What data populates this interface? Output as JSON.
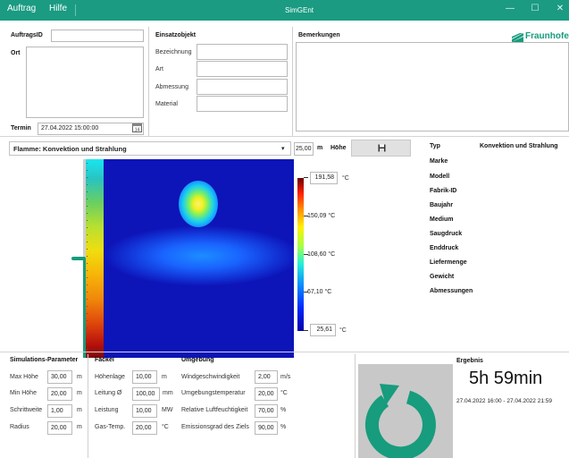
{
  "window": {
    "title": "SimGEnt",
    "menu": [
      "Auftrag",
      "Hilfe"
    ],
    "controls": [
      "—",
      "☐",
      "✕"
    ]
  },
  "order": {
    "id_label": "AuftragsID",
    "id_value": "",
    "place_label": "Ort",
    "date_label": "Termin",
    "date_value": "27.04.2022 15:00:00"
  },
  "object": {
    "title": "Einsatzobjekt",
    "fields": [
      {
        "label": "Bezeichnung",
        "value": ""
      },
      {
        "label": "Art",
        "value": ""
      },
      {
        "label": "Abmessung",
        "value": ""
      },
      {
        "label": "Material",
        "value": ""
      }
    ]
  },
  "remarks": {
    "title": "Bemerkungen",
    "value": ""
  },
  "logo": {
    "text": "Fraunhofer",
    "color": "#179c7d"
  },
  "flame": {
    "selected": "Flamme: Konvektion und Strahlung",
    "height_value": "25,00",
    "height_unit": "m",
    "height_label": "Höhe",
    "slider_level": 0.5
  },
  "heatmap": {
    "max_label": "191,58",
    "max_unit": "°C",
    "min_label": "25,61",
    "min_unit": "°C",
    "ticks": [
      "150,09 °C",
      "108,60 °C",
      "67,10 °C"
    ]
  },
  "info": {
    "rows": [
      {
        "label": "Typ",
        "value": "Konvektion und Strahlung"
      },
      {
        "label": "Marke",
        "value": ""
      },
      {
        "label": "Modell",
        "value": ""
      },
      {
        "label": "Fabrik-ID",
        "value": ""
      },
      {
        "label": "Baujahr",
        "value": ""
      },
      {
        "label": "Medium",
        "value": ""
      },
      {
        "label": "Saugdruck",
        "value": ""
      },
      {
        "label": "Enddruck",
        "value": ""
      },
      {
        "label": "Liefermenge",
        "value": ""
      },
      {
        "label": "Gewicht",
        "value": ""
      },
      {
        "label": "Abmessungen",
        "value": ""
      }
    ]
  },
  "sim_params": {
    "title": "Simulations-Parameter",
    "rows": [
      {
        "label": "Max Höhe",
        "value": "30,00",
        "unit": "m"
      },
      {
        "label": "Min Höhe",
        "value": "20,00",
        "unit": "m"
      },
      {
        "label": "Schrittweite",
        "value": "1,00",
        "unit": "m"
      },
      {
        "label": "Radius",
        "value": "20,00",
        "unit": "m"
      }
    ]
  },
  "torch": {
    "title": "Fackel",
    "rows": [
      {
        "label": "Höhenlage",
        "value": "10,00",
        "unit": "m"
      },
      {
        "label": "Leitung Ø",
        "value": "100,00",
        "unit": "mm"
      },
      {
        "label": "Leistung",
        "value": "10,00",
        "unit": "MW"
      },
      {
        "label": "Gas-Temp.",
        "value": "20,00",
        "unit": "°C"
      }
    ]
  },
  "environment": {
    "title": "Umgebung",
    "rows": [
      {
        "label": "Windgeschwindigkeit",
        "value": "2,00",
        "unit": "m/s"
      },
      {
        "label": "Umgebungstemperatur",
        "value": "20,00",
        "unit": "°C"
      },
      {
        "label": "Relative Luftfeuchtigkeit",
        "value": "70,00",
        "unit": "%"
      },
      {
        "label": "Emissionsgrad des Ziels",
        "value": "90,00",
        "unit": "%"
      }
    ]
  },
  "result": {
    "title": "Ergebnis",
    "duration": "5h 59min",
    "range": "27.04.2022 16:00 - 27.04.2022 21:59",
    "accent": "#179c7d"
  }
}
